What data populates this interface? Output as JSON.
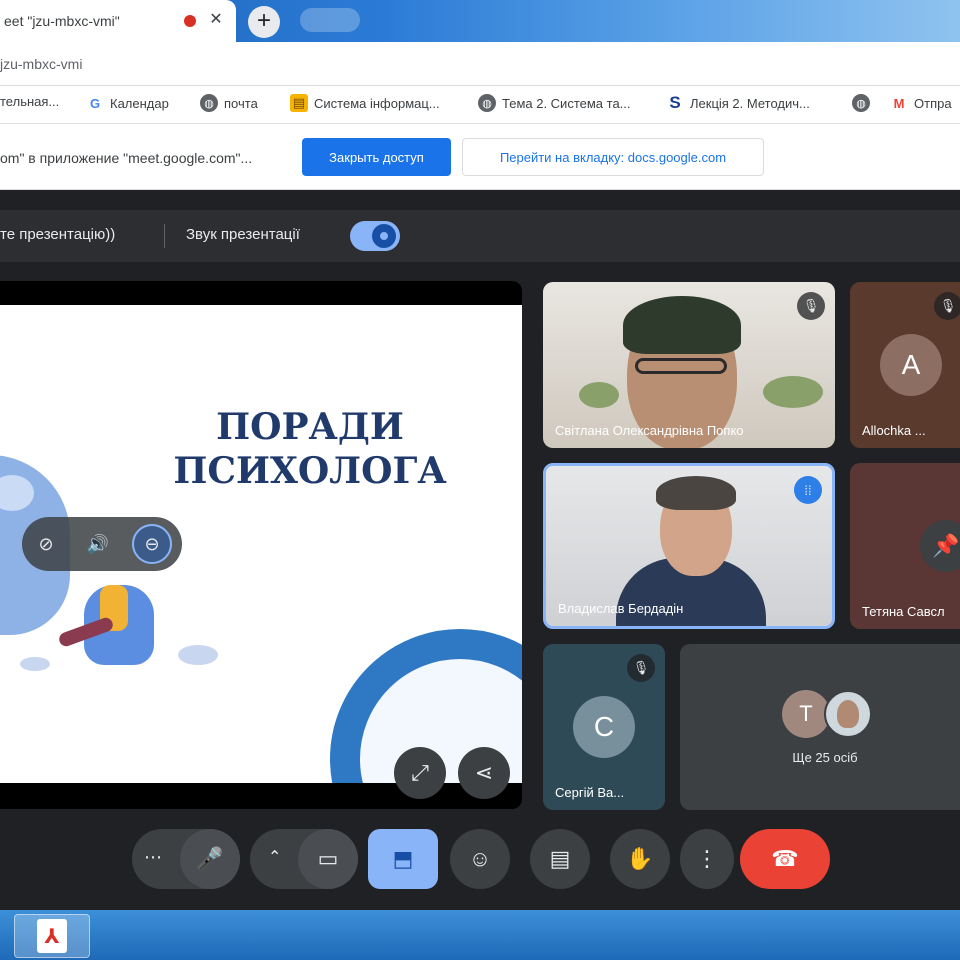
{
  "browser": {
    "tab_title": "eet \"jzu-mbxc-vmi\"",
    "tab_close": "✕",
    "new_tab": "+",
    "url": "jzu-mbxc-vmi",
    "bookmarks": [
      {
        "label": "тельная...",
        "icon": "bookmark-icon"
      },
      {
        "label": "Календар",
        "icon": "google-icon"
      },
      {
        "label": "почта",
        "icon": "globe-icon"
      },
      {
        "label": "Система інформац...",
        "icon": "system-icon"
      },
      {
        "label": "Тема 2. Система та...",
        "icon": "globe-icon"
      },
      {
        "label": "Лекція 2. Методич...",
        "icon": "s-icon"
      },
      {
        "label": "Отпра",
        "icon": "gmail-icon"
      }
    ]
  },
  "infobar": {
    "text": "om\" в приложение \"meet.google.com\"...",
    "close_access": "Закрыть доступ",
    "go_to_tab": "Перейти на вкладку: docs.google.com"
  },
  "presentation_bar": {
    "label": "те презентацію))",
    "audio_label": "Звук презентації",
    "audio_on": true
  },
  "slide": {
    "title_line1": "ПОРАДИ",
    "title_line2": "ПСИХОЛОГА"
  },
  "participants": [
    {
      "name": "Світлана Олександрівна Попко",
      "initial": "",
      "muted": true
    },
    {
      "name": "Allochka ...",
      "initial": "A",
      "muted": true,
      "avatar_color": "#8d6e63"
    },
    {
      "name": "Владислав Бердадін",
      "initial": "",
      "speaking": true
    },
    {
      "name": "Тетяна Савсл",
      "initial": "",
      "pinned": true
    },
    {
      "name": "Сергій Ва...",
      "initial": "C",
      "muted": true,
      "avatar_color": "#78909c"
    }
  ],
  "others": {
    "initial": "T",
    "label": "Ще 25 осіб",
    "avatar_color": "#a1887f"
  },
  "colors": {
    "accent": "#8ab4f8",
    "end_call": "#ea4335",
    "primary_button": "#1a73e8"
  }
}
